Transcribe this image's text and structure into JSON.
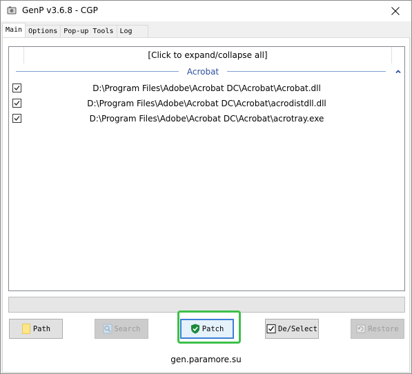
{
  "window": {
    "title": "GenP v3.6.8 - CGP"
  },
  "tabs": [
    {
      "label": "Main"
    },
    {
      "label": "Options"
    },
    {
      "label": "Pop-up Tools"
    },
    {
      "label": "Log"
    }
  ],
  "main": {
    "expand_all_label": "[Click to expand/collapse all]",
    "groups": [
      {
        "name": "Acrobat",
        "files": [
          {
            "path": "D:\\Program Files\\Adobe\\Acrobat DC\\Acrobat\\Acrobat.dll",
            "checked": true
          },
          {
            "path": "D:\\Program Files\\Adobe\\Acrobat DC\\Acrobat\\acrodistdll.dll",
            "checked": true
          },
          {
            "path": "D:\\Program Files\\Adobe\\Acrobat DC\\Acrobat\\acrotray.exe",
            "checked": true
          }
        ]
      }
    ],
    "progress_fraction": 0
  },
  "buttons": {
    "path": {
      "label": "Path",
      "icon": "folder-icon",
      "enabled": true
    },
    "search": {
      "label": "Search",
      "icon": "search-icon",
      "enabled": false
    },
    "patch": {
      "label": "Patch",
      "icon": "shield-check-icon",
      "enabled": true
    },
    "deselect": {
      "label": "De/Select",
      "icon": "checkbox-icon",
      "enabled": true
    },
    "restore": {
      "label": "Restore",
      "icon": "restore-icon",
      "enabled": false
    }
  },
  "footer": {
    "text": "gen.paramore.su"
  },
  "colors": {
    "highlight": "#3cc04a",
    "group_label": "#2e4f9e",
    "group_line": "#7d9fd3"
  }
}
